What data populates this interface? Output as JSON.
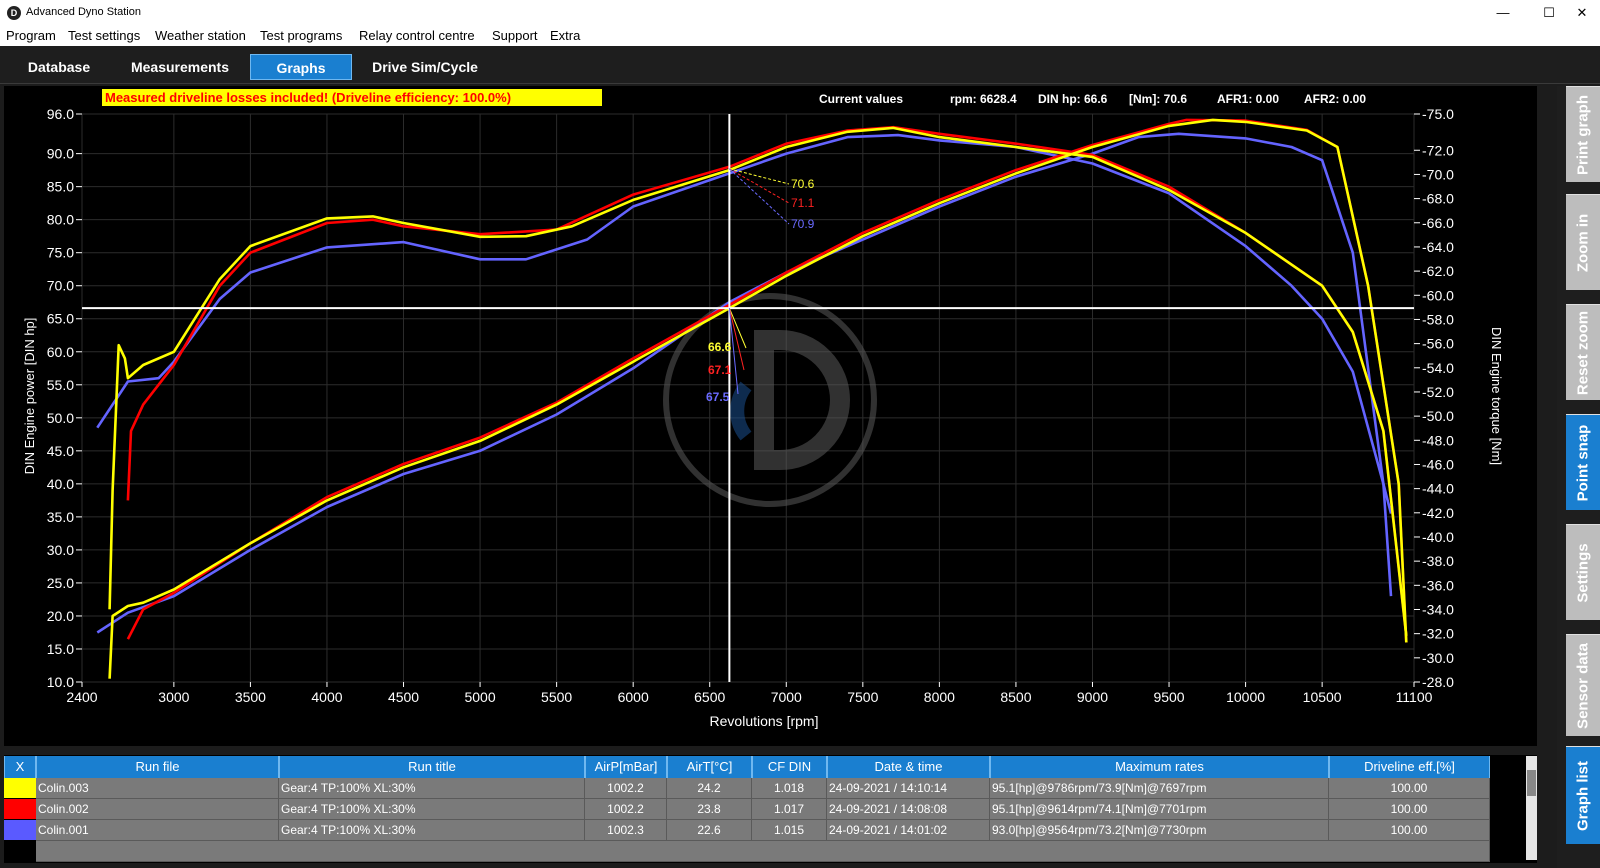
{
  "window": {
    "title": "Advanced Dyno Station",
    "logo_letter": "D",
    "controls": [
      "—",
      "☐",
      "✕"
    ]
  },
  "menu": [
    "Program",
    "Test settings",
    "Weather station",
    "Test programs",
    "Relay control centre",
    "Support",
    "Extra"
  ],
  "tabs": [
    {
      "label": "Database",
      "active": false
    },
    {
      "label": "Measurements",
      "active": false
    },
    {
      "label": "Graphs",
      "active": true
    },
    {
      "label": "Drive Sim/Cycle",
      "active": false
    }
  ],
  "chart": {
    "warning": "Measured driveline losses included! (Driveline efficiency: 100.0%)",
    "current_values": {
      "label": "Current values",
      "rpm": "rpm: 6628.4",
      "hp": "DIN hp: 66.6",
      "nm": "[Nm]: 70.6",
      "afr1": "AFR1: 0.00",
      "afr2": "AFR2: 0.00"
    },
    "snap_labels_torque": [
      {
        "text": "70.6",
        "color": "#ffff33"
      },
      {
        "text": "71.1",
        "color": "#ff2222"
      },
      {
        "text": "70.9",
        "color": "#6a6aff"
      }
    ],
    "snap_labels_power": [
      {
        "text": "66.6",
        "color": "#ffff33"
      },
      {
        "text": "67.1",
        "color": "#ff2222"
      },
      {
        "text": "67.5",
        "color": "#6a6aff"
      }
    ],
    "colors": {
      "yellow": "#ffff00",
      "red": "#ff0000",
      "blue": "#6464ff",
      "crosshair": "#ffffff",
      "grid": "#333333"
    }
  },
  "chart_data": {
    "type": "line",
    "xlabel": "Revolutions [rpm]",
    "ylabel_left": "DIN Engine power [DIN hp]",
    "ylabel_right": "DIN Engine torque [Nm]",
    "xlim": [
      2400,
      11100
    ],
    "ylim_left": [
      10,
      96
    ],
    "ylim_right": [
      -28,
      -75
    ],
    "x_ticks": [
      "2400",
      "3000",
      "3500",
      "4000",
      "4500",
      "5000",
      "5500",
      "6000",
      "6500",
      "7000",
      "7500",
      "8000",
      "8500",
      "9000",
      "9500",
      "10000",
      "10500",
      "11100"
    ],
    "y_ticks_left": [
      "96.0",
      "90.0",
      "85.0",
      "80.0",
      "75.0",
      "70.0",
      "65.0",
      "60.0",
      "55.0",
      "50.0",
      "45.0",
      "40.0",
      "35.0",
      "30.0",
      "25.0",
      "20.0",
      "15.0",
      "10.0"
    ],
    "y_ticks_right": [
      "-75.0",
      "-72.0",
      "-70.0",
      "-68.0",
      "-66.0",
      "-64.0",
      "-62.0",
      "-60.0",
      "-58.0",
      "-56.0",
      "-54.0",
      "-52.0",
      "-50.0",
      "-48.0",
      "-46.0",
      "-44.0",
      "-42.0",
      "-40.0",
      "-38.0",
      "-36.0",
      "-34.0",
      "-32.0",
      "-30.0",
      "-28.0"
    ],
    "crosshair": {
      "rpm": 6628.4,
      "hp": 66.6
    },
    "series": [
      {
        "name": "Colin.003",
        "color": "#ffff00",
        "power": [
          [
            2580,
            10.5
          ],
          [
            2600,
            20
          ],
          [
            2700,
            21.5
          ],
          [
            2800,
            22
          ],
          [
            3000,
            24
          ],
          [
            3500,
            31
          ],
          [
            4000,
            37.5
          ],
          [
            4500,
            42.5
          ],
          [
            5000,
            46.5
          ],
          [
            5500,
            52
          ],
          [
            6000,
            58.5
          ],
          [
            6628,
            66.6
          ],
          [
            7000,
            71.5
          ],
          [
            7500,
            77.5
          ],
          [
            8000,
            82.5
          ],
          [
            8500,
            87
          ],
          [
            9000,
            91
          ],
          [
            9500,
            94.2
          ],
          [
            9786,
            95.1
          ],
          [
            10000,
            94.8
          ],
          [
            10400,
            93.5
          ],
          [
            10600,
            91
          ],
          [
            10800,
            70
          ],
          [
            11000,
            40
          ],
          [
            11050,
            16
          ]
        ],
        "torque": [
          [
            2580,
            21
          ],
          [
            2600,
            39
          ],
          [
            2640,
            61
          ],
          [
            2680,
            59
          ],
          [
            2700,
            56
          ],
          [
            2800,
            58
          ],
          [
            3000,
            60
          ],
          [
            3300,
            71
          ],
          [
            3500,
            76
          ],
          [
            4000,
            80.2
          ],
          [
            4300,
            80.5
          ],
          [
            4500,
            79.5
          ],
          [
            5000,
            77.4
          ],
          [
            5300,
            77.5
          ],
          [
            5600,
            79
          ],
          [
            6000,
            83
          ],
          [
            6628,
            87.5
          ],
          [
            7000,
            91
          ],
          [
            7400,
            93.3
          ],
          [
            7697,
            93.9
          ],
          [
            8000,
            92.5
          ],
          [
            8500,
            91
          ],
          [
            9000,
            89.5
          ],
          [
            9500,
            84.5
          ],
          [
            10000,
            78
          ],
          [
            10500,
            70
          ],
          [
            10700,
            63
          ],
          [
            10900,
            48
          ],
          [
            11050,
            17
          ]
        ]
      },
      {
        "name": "Colin.002",
        "color": "#ff0000",
        "power": [
          [
            2700,
            16.5
          ],
          [
            2800,
            21
          ],
          [
            3000,
            23.5
          ],
          [
            3500,
            31
          ],
          [
            4000,
            38
          ],
          [
            4500,
            43
          ],
          [
            5000,
            47
          ],
          [
            5500,
            52.3
          ],
          [
            6000,
            59
          ],
          [
            6628,
            67.1
          ],
          [
            7000,
            72
          ],
          [
            7500,
            78
          ],
          [
            8000,
            83
          ],
          [
            8500,
            87.5
          ],
          [
            9000,
            91.3
          ],
          [
            9500,
            94.5
          ],
          [
            9614,
            95.1
          ],
          [
            10000,
            95
          ],
          [
            10400,
            93.6
          ],
          [
            10600,
            91
          ],
          [
            10800,
            70
          ],
          [
            11000,
            40
          ],
          [
            11050,
            16
          ]
        ],
        "torque": [
          [
            2700,
            37.5
          ],
          [
            2720,
            48
          ],
          [
            2800,
            52
          ],
          [
            3000,
            58
          ],
          [
            3300,
            70
          ],
          [
            3500,
            75
          ],
          [
            4000,
            79.5
          ],
          [
            4300,
            80
          ],
          [
            4500,
            79
          ],
          [
            5000,
            77.8
          ],
          [
            5500,
            78.5
          ],
          [
            6000,
            83.8
          ],
          [
            6628,
            88
          ],
          [
            7000,
            91.5
          ],
          [
            7400,
            93.5
          ],
          [
            7701,
            94
          ],
          [
            8000,
            93
          ],
          [
            8500,
            91.5
          ],
          [
            9000,
            89.8
          ],
          [
            9500,
            85
          ],
          [
            10000,
            78
          ],
          [
            10500,
            70
          ],
          [
            10700,
            63
          ],
          [
            10900,
            48
          ],
          [
            11050,
            17
          ]
        ]
      },
      {
        "name": "Colin.001",
        "color": "#6464ff",
        "power": [
          [
            2500,
            17.5
          ],
          [
            2700,
            20.5
          ],
          [
            3000,
            23
          ],
          [
            3500,
            30
          ],
          [
            4000,
            36.5
          ],
          [
            4500,
            41.5
          ],
          [
            5000,
            45
          ],
          [
            5500,
            50.5
          ],
          [
            6000,
            57.5
          ],
          [
            6628,
            67.5
          ],
          [
            7000,
            72
          ],
          [
            7500,
            77
          ],
          [
            8000,
            82
          ],
          [
            8500,
            86.5
          ],
          [
            9000,
            90
          ],
          [
            9300,
            92.5
          ],
          [
            9564,
            93.0
          ],
          [
            10000,
            92.3
          ],
          [
            10300,
            91
          ],
          [
            10500,
            89
          ],
          [
            10700,
            75
          ],
          [
            10900,
            40
          ],
          [
            10950,
            23
          ]
        ],
        "torque": [
          [
            2500,
            48.5
          ],
          [
            2700,
            55.5
          ],
          [
            2900,
            56
          ],
          [
            3000,
            58.5
          ],
          [
            3300,
            68
          ],
          [
            3500,
            72
          ],
          [
            4000,
            75.8
          ],
          [
            4500,
            76.6
          ],
          [
            5000,
            74
          ],
          [
            5300,
            74
          ],
          [
            5700,
            77
          ],
          [
            6000,
            82
          ],
          [
            6628,
            87
          ],
          [
            7000,
            90
          ],
          [
            7400,
            92.5
          ],
          [
            7730,
            92.8
          ],
          [
            8000,
            92
          ],
          [
            8500,
            91
          ],
          [
            9000,
            88.5
          ],
          [
            9500,
            84
          ],
          [
            10000,
            76
          ],
          [
            10300,
            70
          ],
          [
            10500,
            65
          ],
          [
            10700,
            57
          ],
          [
            10900,
            40
          ],
          [
            10950,
            35.5
          ]
        ]
      }
    ]
  },
  "table": {
    "headers": [
      "X",
      "Run file",
      "Run title",
      "AirP[mBar]",
      "AirT[°C]",
      "CF DIN",
      "Date & time",
      "Maximum rates",
      "Driveline eff.[%]"
    ],
    "rows": [
      {
        "color": "#ffff00",
        "file": "Colin.003",
        "title": "Gear:4 TP:100% XL:30%",
        "airp": "1002.2",
        "airt": "24.2",
        "cf": "1.018",
        "date": "24-09-2021 / 14:10:14",
        "max": "95.1[hp]@9786rpm/73.9[Nm]@7697rpm",
        "eff": "100.00"
      },
      {
        "color": "#ff0000",
        "file": "Colin.002",
        "title": "Gear:4 TP:100% XL:30%",
        "airp": "1002.2",
        "airt": "23.8",
        "cf": "1.017",
        "date": "24-09-2021 / 14:08:08",
        "max": "95.1[hp]@9614rpm/74.1[Nm]@7701rpm",
        "eff": "100.00"
      },
      {
        "color": "#5a5aff",
        "file": "Colin.001",
        "title": "Gear:4 TP:100% XL:30%",
        "airp": "1002.3",
        "airt": "22.6",
        "cf": "1.015",
        "date": "24-09-2021 / 14:01:02",
        "max": "93.0[hp]@9564rpm/73.2[Nm]@7730rpm",
        "eff": "100.00"
      }
    ]
  },
  "sidebar": [
    {
      "label": "Print graph",
      "active": false
    },
    {
      "label": "Zoom in",
      "active": false
    },
    {
      "label": "Reset zoom",
      "active": false
    },
    {
      "label": "Point snap",
      "active": true
    },
    {
      "label": "Settings",
      "active": false
    },
    {
      "label": "Sensor data",
      "active": false
    },
    {
      "label": "Graph list",
      "active": true
    }
  ]
}
